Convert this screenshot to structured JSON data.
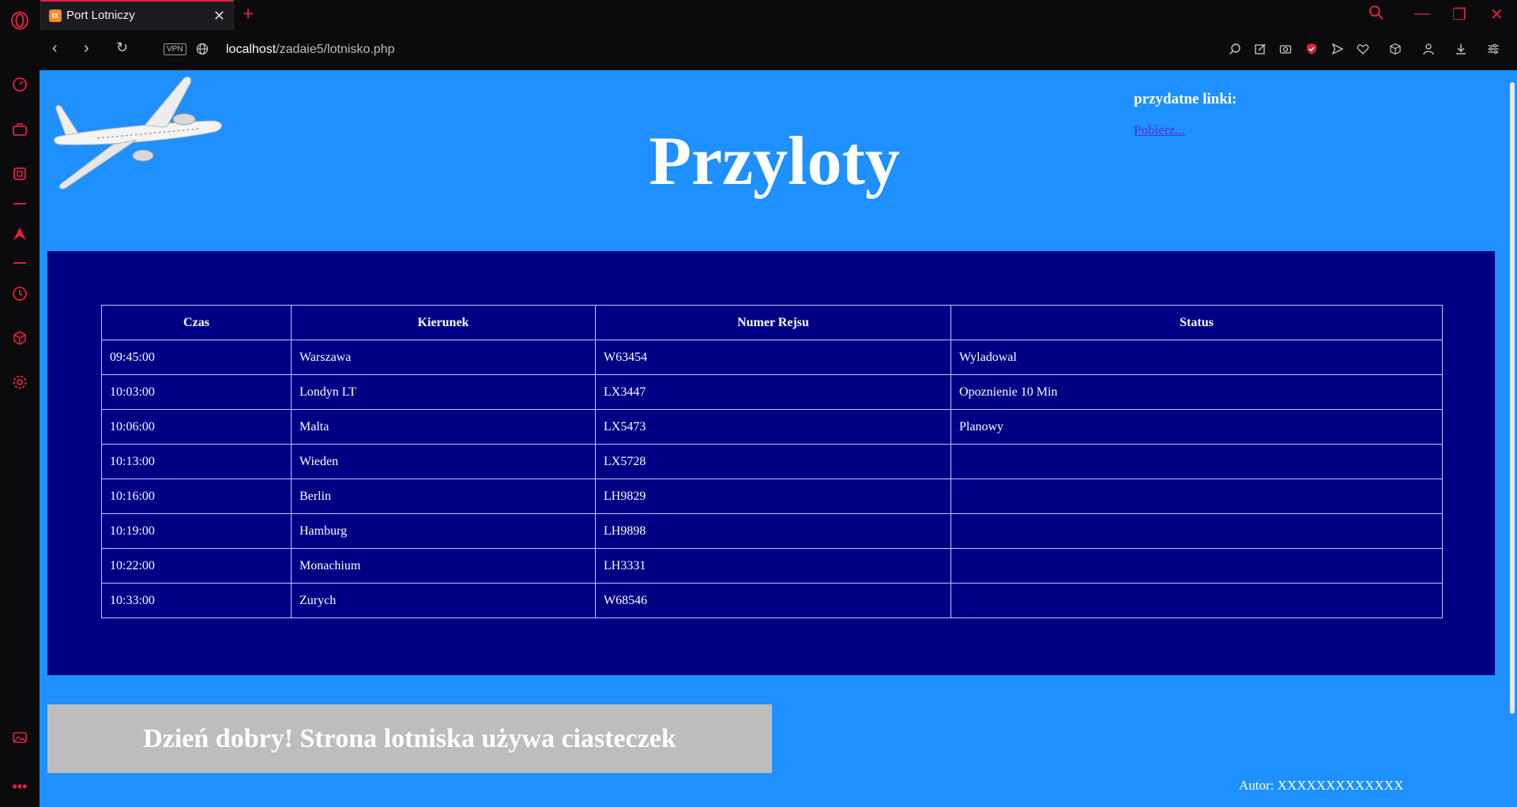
{
  "browser": {
    "tab_title": "Port Lotniczy",
    "tab_favicon_text": "IX",
    "url_host": "localhost",
    "url_path": "/zadaie5/lotnisko.php",
    "vpn_label": "VPN",
    "accent_color": "#e0213a"
  },
  "page": {
    "heading": "Przyloty",
    "links_title": "przydatne linki:",
    "download_link": "Pobierz...",
    "table": {
      "headers": [
        "Czas",
        "Kierunek",
        "Numer Rejsu",
        "Status"
      ],
      "rows": [
        [
          "09:45:00",
          "Warszawa",
          "W63454",
          "Wyladowal"
        ],
        [
          "10:03:00",
          "Londyn LT",
          "LX3447",
          "Opoznienie 10 Min"
        ],
        [
          "10:06:00",
          "Malta",
          "LX5473",
          "Planowy"
        ],
        [
          "10:13:00",
          "Wieden",
          "LX5728",
          ""
        ],
        [
          "10:16:00",
          "Berlin",
          "LH9829",
          ""
        ],
        [
          "10:19:00",
          "Hamburg",
          "LH9898",
          ""
        ],
        [
          "10:22:00",
          "Monachium",
          "LH3331",
          ""
        ],
        [
          "10:33:00",
          "Zurych",
          "W68546",
          ""
        ]
      ]
    },
    "cookie_message": "Dzień dobry! Strona lotniska używa ciasteczek",
    "author": "Autor: XXXXXXXXXXXXX",
    "colors": {
      "background": "#1e90ff",
      "board": "#000085",
      "cookie_box": "#bdbdbd"
    }
  }
}
